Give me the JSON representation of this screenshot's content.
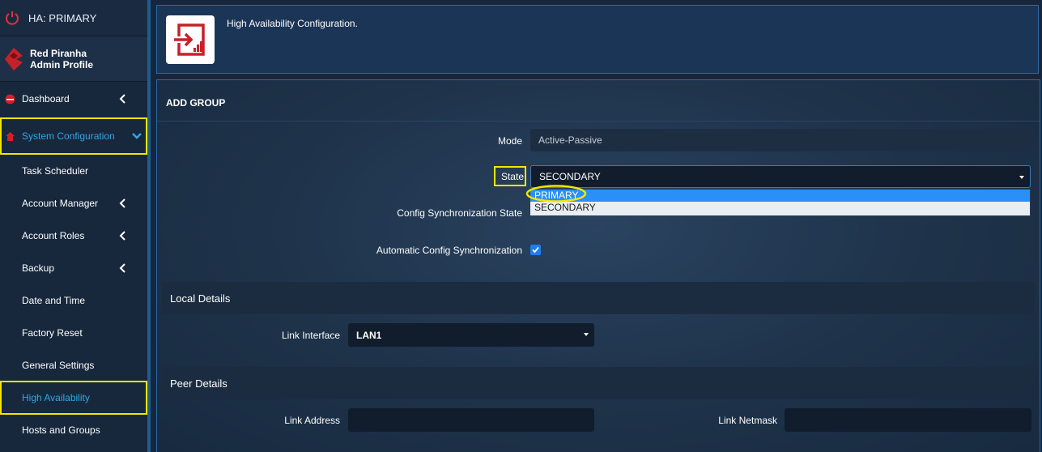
{
  "sidebar": {
    "ha_status": "HA: PRIMARY",
    "profile": {
      "name": "Red Piranha",
      "role": "Admin Profile"
    },
    "items": [
      {
        "label": "Dashboard"
      },
      {
        "label": "System Configuration"
      },
      {
        "label": "Task Scheduler"
      },
      {
        "label": "Account Manager"
      },
      {
        "label": "Account Roles"
      },
      {
        "label": "Backup"
      },
      {
        "label": "Date and Time"
      },
      {
        "label": "Factory Reset"
      },
      {
        "label": "General Settings"
      },
      {
        "label": "High Availability"
      },
      {
        "label": "Hosts and Groups"
      }
    ]
  },
  "header": {
    "title": "High Availability Configuration."
  },
  "main": {
    "section_title": "ADD GROUP",
    "mode": {
      "label": "Mode",
      "value": "Active-Passive"
    },
    "state": {
      "label": "State",
      "value": "SECONDARY",
      "options": [
        "PRIMARY",
        "SECONDARY"
      ],
      "highlighted_option": "PRIMARY"
    },
    "config_sync_state": {
      "label": "Config Synchronization State"
    },
    "auto_config_sync": {
      "label": "Automatic Config Synchronization",
      "checked": true
    },
    "local_details": {
      "title": "Local Details",
      "link_interface": {
        "label": "Link Interface",
        "value": "LAN1"
      }
    },
    "peer_details": {
      "title": "Peer Details",
      "link_address": {
        "label": "Link Address",
        "value": ""
      },
      "link_netmask": {
        "label": "Link Netmask",
        "value": ""
      }
    }
  },
  "colors": {
    "accent": "#34a6e6",
    "highlight": "#f2e600",
    "brand_red": "#d12027",
    "selected_option": "#2a8ff7"
  }
}
